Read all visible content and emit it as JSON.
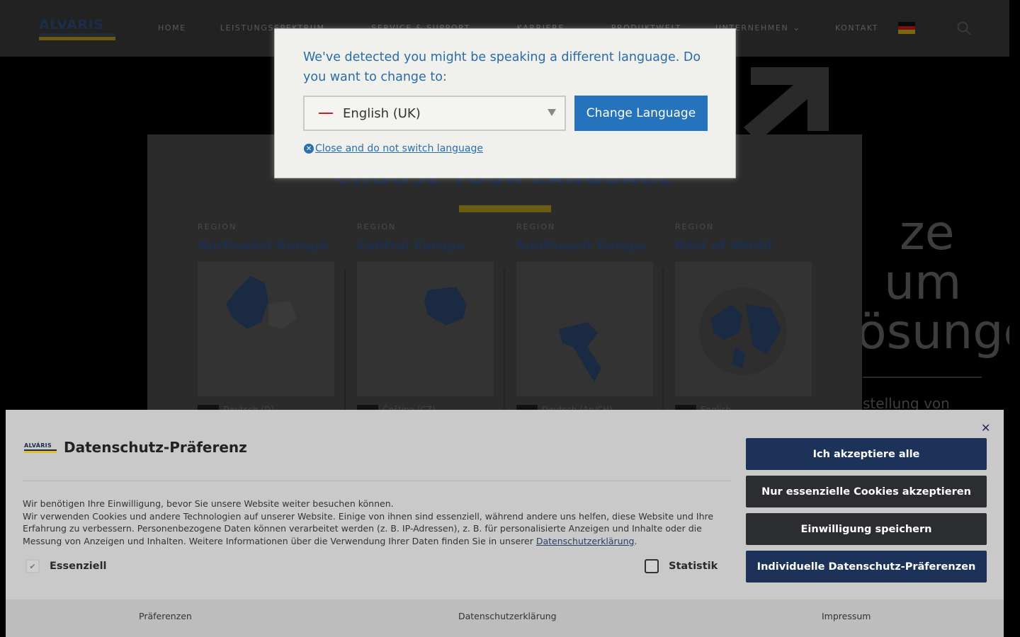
{
  "header": {
    "logo_text": "ALVÁRIS",
    "nav": [
      {
        "label": "HOME",
        "has_dropdown": false
      },
      {
        "label": "LEISTUNGSSPEKTRUM",
        "has_dropdown": true
      },
      {
        "label": "SERVICE & SUPPORT",
        "has_dropdown": true
      },
      {
        "label": "KARRIERE",
        "has_dropdown": true
      },
      {
        "label": "PRODUKTWELT",
        "has_dropdown": false
      },
      {
        "label": "UNTERNEHMEN",
        "has_dropdown": true
      },
      {
        "label": "KONTAKT",
        "has_dropdown": false
      }
    ],
    "flag_colors": [
      "#0a0a0a",
      "#7a1010",
      "#7a6510"
    ]
  },
  "hero": {
    "lines": [
      "ze",
      "um",
      "ösunge"
    ],
    "subtitle": "stellung von"
  },
  "region_panel": {
    "title": "CHOOSE YOUR LANGUAGE",
    "regions": [
      {
        "label": "REGION",
        "name": "Northwest Europe",
        "lang": "Deutsch (D)"
      },
      {
        "label": "REGION",
        "name": "Central Europe",
        "lang": "Čeština (CZ)"
      },
      {
        "label": "REGION",
        "name": "Southwest Europe",
        "lang": "Deutsch (An/CH)"
      },
      {
        "label": "REGION",
        "name": "Rest of World",
        "lang": "English"
      }
    ]
  },
  "language_dialog": {
    "message": "We've detected you might be speaking a different language. Do you want to change to:",
    "selected_language": "English (UK)",
    "change_button": "Change Language",
    "close_link": "Close and do not switch language"
  },
  "cookie_banner": {
    "logo_text": "ALVÁRIS",
    "title": "Datenschutz-Präferenz",
    "intro": "Wir benötigen Ihre Einwilligung, bevor Sie unsere Website weiter besuchen können.",
    "body": "Wir verwenden Cookies und andere Technologien auf unserer Website. Einige von ihnen sind essenziell, während andere uns helfen, diese Website und Ihre Erfahrung zu verbessern. Personenbezogene Daten können verarbeitet werden (z. B. IP-Adressen), z. B. für personalisierte Anzeigen und Inhalte oder die Messung von Anzeigen und Inhalten. Weitere Informationen über die Verwendung Ihrer Daten finden Sie in unserer",
    "privacy_link": "Datenschutzerklärung",
    "period": ".",
    "checkboxes": [
      {
        "label": "Essenziell",
        "checked": true,
        "disabled": true
      },
      {
        "label": "Statistik",
        "checked": false,
        "disabled": false
      }
    ],
    "buttons": {
      "accept_all": "Ich akzeptiere alle",
      "essential_only": "Nur essenzielle Cookies akzeptieren",
      "save": "Einwilligung speichern",
      "individual": "Individuelle Datenschutz-Präferenzen"
    },
    "footer": {
      "preferences": "Präferenzen",
      "privacy": "Datenschutzerklärung",
      "imprint": "Impressum"
    },
    "colors": {
      "navy": "#1c3259",
      "dark": "#2c2d31",
      "accent_yellow": "#e2be2a"
    }
  }
}
